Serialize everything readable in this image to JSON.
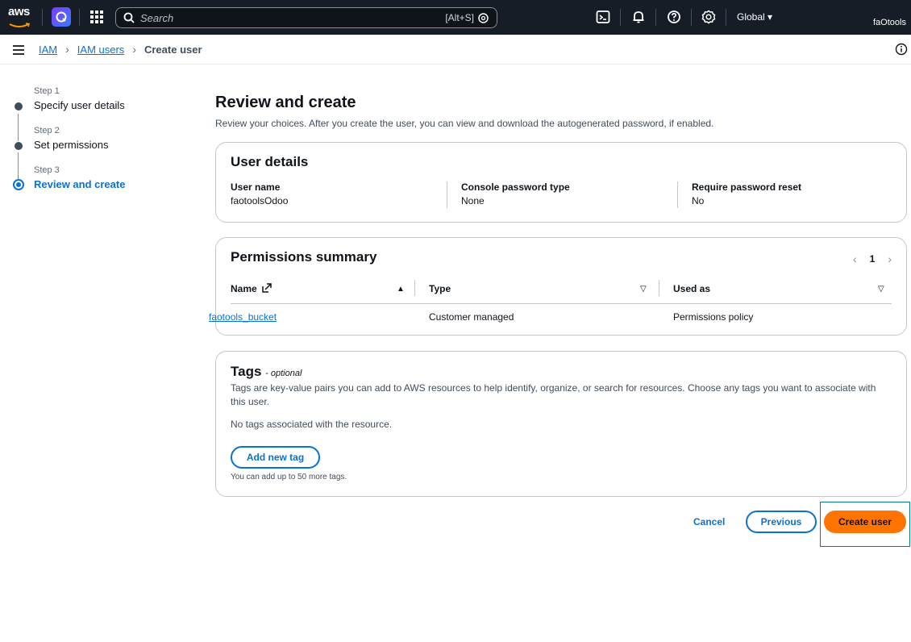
{
  "topnav": {
    "logo_text": "aws",
    "search_placeholder": "Search",
    "search_shortcut": "[Alt+S]",
    "region": "Global ▾",
    "account": "faOtools"
  },
  "breadcrumb": {
    "items": [
      "IAM",
      "IAM users"
    ],
    "current": "Create user"
  },
  "steps": [
    {
      "step": "Step 1",
      "label": "Specify user details"
    },
    {
      "step": "Step 2",
      "label": "Set permissions"
    },
    {
      "step": "Step 3",
      "label": "Review and create"
    }
  ],
  "page": {
    "title": "Review and create",
    "description": "Review your choices. After you create the user, you can view and download the autogenerated password, if enabled."
  },
  "user_details": {
    "title": "User details",
    "fields": [
      {
        "key": "User name",
        "value": "faotoolsOdoo"
      },
      {
        "key": "Console password type",
        "value": "None"
      },
      {
        "key": "Require password reset",
        "value": "No"
      }
    ]
  },
  "permissions": {
    "title": "Permissions summary",
    "page": "1",
    "columns": [
      "Name",
      "Type",
      "Used as"
    ],
    "rows": [
      {
        "name": "faotools_bucket",
        "type": "Customer managed",
        "used_as": "Permissions policy"
      }
    ]
  },
  "tags": {
    "title": "Tags",
    "optional": "- optional",
    "description": "Tags are key-value pairs you can add to AWS resources to help identify, organize, or search for resources. Choose any tags you want to associate with this user.",
    "empty": "No tags associated with the resource.",
    "add_button": "Add new tag",
    "note": "You can add up to 50 more tags."
  },
  "actions": {
    "cancel": "Cancel",
    "previous": "Previous",
    "create": "Create user"
  },
  "colors": {
    "nav_bg": "#161d26",
    "link": "#0972d3",
    "primary": "#ff7400"
  }
}
